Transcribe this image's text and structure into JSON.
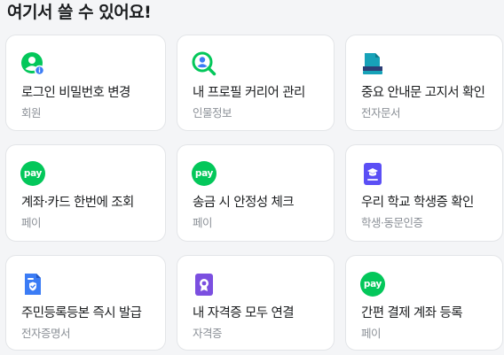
{
  "page": {
    "title": "여기서 쓸 수 있어요!"
  },
  "services": [
    {
      "label": "로그인 비밀번호 변경",
      "category": "회원",
      "icon": "user-info-icon"
    },
    {
      "label": "내 프로필 커리어 관리",
      "category": "인물정보",
      "icon": "profile-search-icon"
    },
    {
      "label": "중요 안내문 고지서 확인",
      "category": "전자문서",
      "icon": "document-stack-icon"
    },
    {
      "label": "계좌·카드 한번에 조회",
      "category": "페이",
      "icon": "pay-icon",
      "badge": "pay"
    },
    {
      "label": "송금 시 안정성 체크",
      "category": "페이",
      "icon": "pay-icon",
      "badge": "pay"
    },
    {
      "label": "우리 학교 학생증 확인",
      "category": "학생·동문인증",
      "icon": "student-id-icon"
    },
    {
      "label": "주민등록등본 즉시 발급",
      "category": "전자증명서",
      "icon": "certificate-doc-icon"
    },
    {
      "label": "내 자격증 모두 연결",
      "category": "자격증",
      "icon": "license-badge-icon"
    },
    {
      "label": "간편 결제 계좌 등록",
      "category": "페이",
      "icon": "pay-icon",
      "badge": "pay"
    }
  ],
  "colors": {
    "naver_green": "#03c75a",
    "document_teal": "#17a2b8",
    "student_purple": "#5b4ff5",
    "certificate_blue": "#3b7cf5",
    "license_purple": "#7b4fe0",
    "category_gray": "#8b9097"
  }
}
